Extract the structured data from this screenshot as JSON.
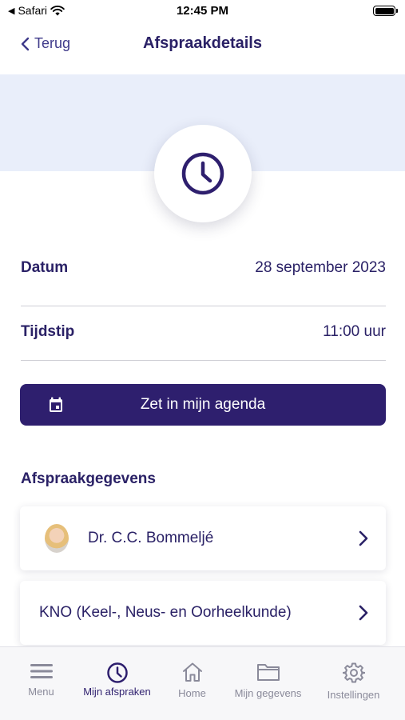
{
  "status_bar": {
    "carrier": "Safari",
    "time": "12:45 PM"
  },
  "nav": {
    "back_label": "Terug",
    "title": "Afspraakdetails"
  },
  "hero": {
    "icon": "clock-icon"
  },
  "details": {
    "date_label": "Datum",
    "date_value": "28 september 2023",
    "time_label": "Tijdstip",
    "time_value": "11:00 uur"
  },
  "agenda_button": {
    "label": "Zet in mijn agenda",
    "icon": "calendar-icon"
  },
  "section": {
    "title": "Afspraakgegevens"
  },
  "cards": [
    {
      "label": "Dr. C.C. Bommeljé",
      "icon": "doctor-avatar"
    },
    {
      "label": "KNO (Keel-, Neus- en Oorheelkunde)"
    }
  ],
  "tabbar": {
    "tabs": [
      {
        "label": "Menu",
        "icon": "menu-icon",
        "active": false
      },
      {
        "label": "Mijn afspraken",
        "icon": "clock-icon",
        "active": true
      },
      {
        "label": "Home",
        "icon": "home-icon",
        "active": false
      },
      {
        "label": "Mijn gegevens",
        "icon": "folder-icon",
        "active": false
      },
      {
        "label": "Instellingen",
        "icon": "gear-icon",
        "active": false
      }
    ]
  },
  "colors": {
    "primary": "#2e1f6e",
    "text": "#2a2166",
    "hero_bg": "#e9eefa",
    "inactive": "#8a8a9a"
  }
}
